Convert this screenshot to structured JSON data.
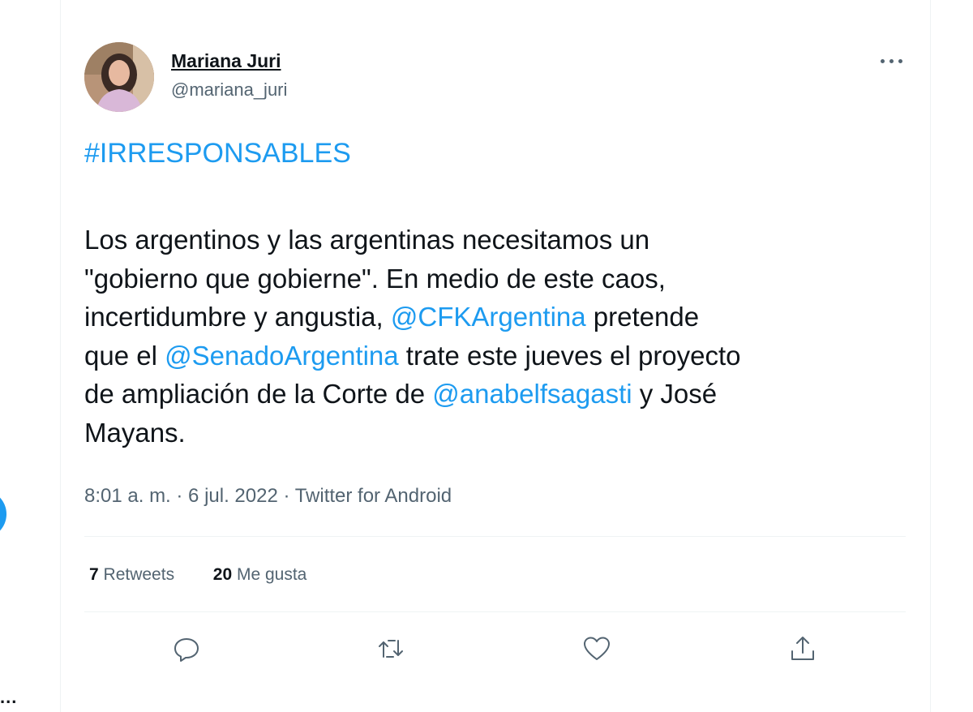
{
  "author": {
    "name": "Mariana Juri",
    "handle": "@mariana_juri"
  },
  "tweet": {
    "hashtag": "#IRRESPONSABLES",
    "line1": "Los argentinos y las argentinas necesitamos un",
    "line2": "\"gobierno que gobierne\". En medio de este caos,",
    "line3_pre": "incertidumbre y angustia, ",
    "mention1": "@CFKArgentina",
    "line3_post": " pretende",
    "line4_pre": "que el ",
    "mention2": "@SenadoArgentina",
    "line4_post": " trate este jueves el proyecto",
    "line5_pre": "de ampliación de la Corte de ",
    "mention3": "@anabelfsagasti",
    "line5_post": " y José",
    "line6": "Mayans."
  },
  "meta": {
    "text": "8:01 a. m. · 6 jul. 2022 · Twitter for Android"
  },
  "stats": {
    "retweets_count": "7",
    "retweets_label": "Retweets",
    "likes_count": "20",
    "likes_label": "Me gusta"
  },
  "icons": [
    "more-options-icon",
    "reply-icon",
    "retweet-icon",
    "like-icon",
    "share-icon"
  ],
  "colors": {
    "accent": "#1d9bf0",
    "text": "#0f1419",
    "secondary": "#536471",
    "divider": "#eff3f4"
  }
}
